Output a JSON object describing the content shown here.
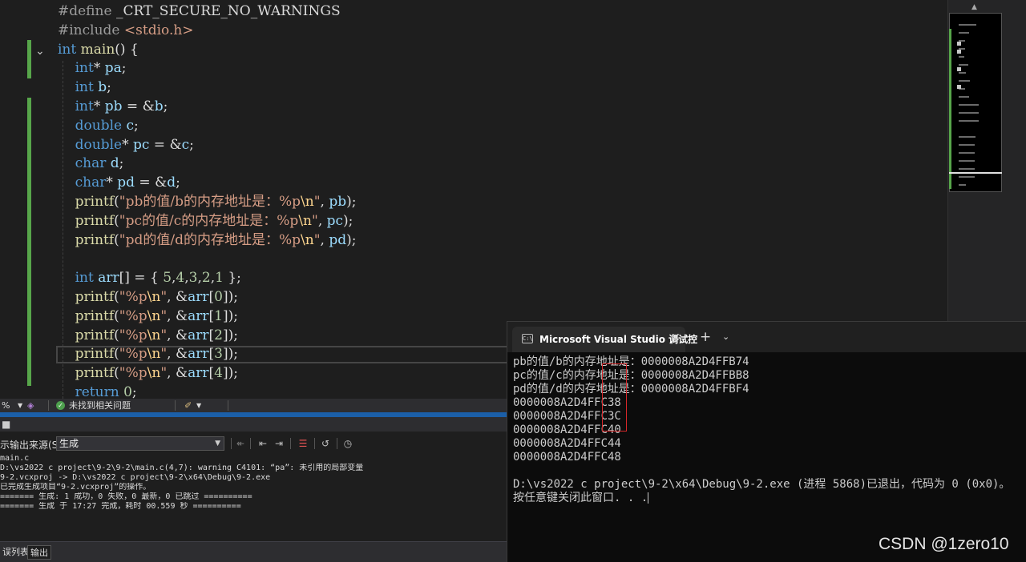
{
  "editor": {
    "lines": [
      [
        [
          "pp",
          "#define "
        ],
        [
          "plain",
          "_CRT_SECURE_NO_WARNINGS"
        ]
      ],
      [
        [
          "pp",
          "#include "
        ],
        [
          "str",
          "<stdio.h>"
        ]
      ],
      [
        [
          "kw",
          "int"
        ],
        [
          "plain",
          " "
        ],
        [
          "fn",
          "main"
        ],
        [
          "plain",
          "() {"
        ]
      ],
      [
        [
          "plain",
          "    "
        ],
        [
          "kw",
          "int"
        ],
        [
          "plain",
          "* "
        ],
        [
          "var",
          "pa"
        ],
        [
          "plain",
          ";"
        ]
      ],
      [
        [
          "plain",
          "    "
        ],
        [
          "kw",
          "int"
        ],
        [
          "plain",
          " "
        ],
        [
          "var",
          "b"
        ],
        [
          "plain",
          ";"
        ]
      ],
      [
        [
          "plain",
          "    "
        ],
        [
          "kw",
          "int"
        ],
        [
          "plain",
          "* "
        ],
        [
          "var",
          "pb"
        ],
        [
          "plain",
          " = &"
        ],
        [
          "var",
          "b"
        ],
        [
          "plain",
          ";"
        ]
      ],
      [
        [
          "plain",
          "    "
        ],
        [
          "kw",
          "double"
        ],
        [
          "plain",
          " "
        ],
        [
          "var",
          "c"
        ],
        [
          "plain",
          ";"
        ]
      ],
      [
        [
          "plain",
          "    "
        ],
        [
          "kw",
          "double"
        ],
        [
          "plain",
          "* "
        ],
        [
          "var",
          "pc"
        ],
        [
          "plain",
          " = &"
        ],
        [
          "var",
          "c"
        ],
        [
          "plain",
          ";"
        ]
      ],
      [
        [
          "plain",
          "    "
        ],
        [
          "kw",
          "char"
        ],
        [
          "plain",
          " "
        ],
        [
          "var",
          "d"
        ],
        [
          "plain",
          ";"
        ]
      ],
      [
        [
          "plain",
          "    "
        ],
        [
          "kw",
          "char"
        ],
        [
          "plain",
          "* "
        ],
        [
          "var",
          "pd"
        ],
        [
          "plain",
          " = &"
        ],
        [
          "var",
          "d"
        ],
        [
          "plain",
          ";"
        ]
      ],
      [
        [
          "plain",
          "    "
        ],
        [
          "fn",
          "printf"
        ],
        [
          "plain",
          "("
        ],
        [
          "str",
          "\"pb的值/b的内存地址是：%p"
        ],
        [
          "esc",
          "\\n"
        ],
        [
          "str",
          "\""
        ],
        [
          "plain",
          ", "
        ],
        [
          "var",
          "pb"
        ],
        [
          "plain",
          ");"
        ]
      ],
      [
        [
          "plain",
          "    "
        ],
        [
          "fn",
          "printf"
        ],
        [
          "plain",
          "("
        ],
        [
          "str",
          "\"pc的值/c的内存地址是：%p"
        ],
        [
          "esc",
          "\\n"
        ],
        [
          "str",
          "\""
        ],
        [
          "plain",
          ", "
        ],
        [
          "var",
          "pc"
        ],
        [
          "plain",
          ");"
        ]
      ],
      [
        [
          "plain",
          "    "
        ],
        [
          "fn",
          "printf"
        ],
        [
          "plain",
          "("
        ],
        [
          "str",
          "\"pd的值/d的内存地址是：%p"
        ],
        [
          "esc",
          "\\n"
        ],
        [
          "str",
          "\""
        ],
        [
          "plain",
          ", "
        ],
        [
          "var",
          "pd"
        ],
        [
          "plain",
          ");"
        ]
      ],
      [],
      [
        [
          "plain",
          "    "
        ],
        [
          "kw",
          "int"
        ],
        [
          "plain",
          " "
        ],
        [
          "var",
          "arr"
        ],
        [
          "plain",
          "[] = { "
        ],
        [
          "num",
          "5"
        ],
        [
          "plain",
          ","
        ],
        [
          "num",
          "4"
        ],
        [
          "plain",
          ","
        ],
        [
          "num",
          "3"
        ],
        [
          "plain",
          ","
        ],
        [
          "num",
          "2"
        ],
        [
          "plain",
          ","
        ],
        [
          "num",
          "1"
        ],
        [
          "plain",
          " };"
        ]
      ],
      [
        [
          "plain",
          "    "
        ],
        [
          "fn",
          "printf"
        ],
        [
          "plain",
          "("
        ],
        [
          "str",
          "\"%p"
        ],
        [
          "esc",
          "\\n"
        ],
        [
          "str",
          "\""
        ],
        [
          "plain",
          ", &"
        ],
        [
          "var",
          "arr"
        ],
        [
          "plain",
          "["
        ],
        [
          "num",
          "0"
        ],
        [
          "plain",
          "]);"
        ]
      ],
      [
        [
          "plain",
          "    "
        ],
        [
          "fn",
          "printf"
        ],
        [
          "plain",
          "("
        ],
        [
          "str",
          "\"%p"
        ],
        [
          "esc",
          "\\n"
        ],
        [
          "str",
          "\""
        ],
        [
          "plain",
          ", &"
        ],
        [
          "var",
          "arr"
        ],
        [
          "plain",
          "["
        ],
        [
          "num",
          "1"
        ],
        [
          "plain",
          "]);"
        ]
      ],
      [
        [
          "plain",
          "    "
        ],
        [
          "fn",
          "printf"
        ],
        [
          "plain",
          "("
        ],
        [
          "str",
          "\"%p"
        ],
        [
          "esc",
          "\\n"
        ],
        [
          "str",
          "\""
        ],
        [
          "plain",
          ", &"
        ],
        [
          "var",
          "arr"
        ],
        [
          "plain",
          "["
        ],
        [
          "num",
          "2"
        ],
        [
          "plain",
          "]);"
        ]
      ],
      [
        [
          "plain",
          "    "
        ],
        [
          "fn",
          "printf"
        ],
        [
          "plain",
          "("
        ],
        [
          "str",
          "\"%p"
        ],
        [
          "esc",
          "\\n"
        ],
        [
          "str",
          "\""
        ],
        [
          "plain",
          ", &"
        ],
        [
          "var",
          "arr"
        ],
        [
          "plain",
          "["
        ],
        [
          "num",
          "3"
        ],
        [
          "plain",
          "]);"
        ]
      ],
      [
        [
          "plain",
          "    "
        ],
        [
          "fn",
          "printf"
        ],
        [
          "plain",
          "("
        ],
        [
          "str",
          "\"%p"
        ],
        [
          "esc",
          "\\n"
        ],
        [
          "str",
          "\""
        ],
        [
          "plain",
          ", &"
        ],
        [
          "var",
          "arr"
        ],
        [
          "plain",
          "["
        ],
        [
          "num",
          "4"
        ],
        [
          "plain",
          "]);"
        ]
      ],
      [
        [
          "plain",
          "    "
        ],
        [
          "kw",
          "return"
        ],
        [
          "plain",
          " "
        ],
        [
          "num",
          "0"
        ],
        [
          "plain",
          ";"
        ]
      ]
    ]
  },
  "status": {
    "zoom": "%",
    "issues": "未找到相关问题"
  },
  "output": {
    "source_label": "示输出来源(S):",
    "source_value": "生成",
    "lines": [
      "main.c",
      "D:\\vs2022 c project\\9-2\\9-2\\main.c(4,7): warning C4101: “pa”: 未引用的局部变量",
      "9-2.vcxproj -> D:\\vs2022 c project\\9-2\\x64\\Debug\\9-2.exe",
      "已完成生成项目“9-2.vcxproj”的操作。",
      "======= 生成: 1 成功，0 失败，0 最新，0 已跳过 ==========",
      "======= 生成 于 17:27 完成，耗时 00.559 秒 =========="
    ],
    "tabs": [
      "误列表",
      "输出"
    ]
  },
  "console": {
    "tab_title": "Microsoft Visual Studio 调试控",
    "add": "+",
    "lines": [
      "pb的值/b的内存地址是：0000008A2D4FFB74",
      "pc的值/c的内存地址是：0000008A2D4FFBB8",
      "pd的值/d的内存地址是：0000008A2D4FFBF4"
    ],
    "arr_prefix": "0000008A2D4FF",
    "arr_suffixes": [
      "C38",
      "C3C",
      "C40",
      "C44",
      "C48"
    ],
    "exit_line": "D:\\vs2022 c project\\9-2\\x64\\Debug\\9-2.exe (进程 5868)已退出，代码为 0 (0x0)。",
    "press_line": "按任意键关闭此窗口. . ."
  },
  "watermark": "CSDN @1zero10"
}
